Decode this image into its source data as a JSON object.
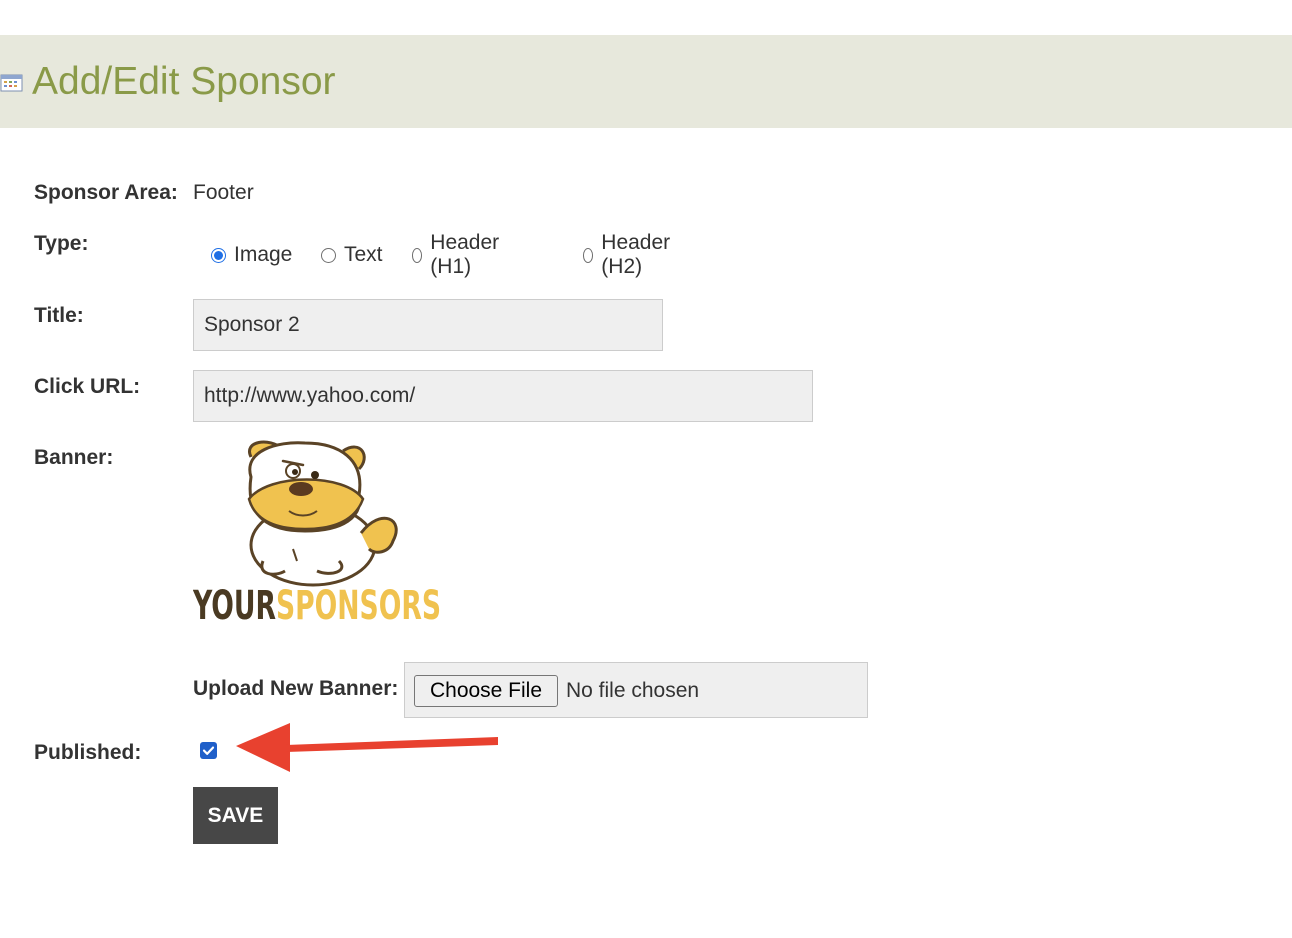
{
  "header": {
    "title": "Add/Edit Sponsor",
    "icon": "calendar-icon"
  },
  "form": {
    "sponsor_area": {
      "label": "Sponsor Area:",
      "value": "Footer"
    },
    "type": {
      "label": "Type:",
      "options": [
        {
          "label": "Image",
          "checked": true
        },
        {
          "label": "Text",
          "checked": false
        },
        {
          "label": "Header (H1)",
          "checked": false
        },
        {
          "label": "Header (H2)",
          "checked": false
        }
      ]
    },
    "title": {
      "label": "Title:",
      "value": "Sponsor 2"
    },
    "click_url": {
      "label": "Click URL:",
      "value": "http://www.yahoo.com/"
    },
    "banner": {
      "label": "Banner:",
      "logo_text_dark": "YOUR",
      "logo_text_accent": "SPONSORS",
      "logo_dark_color": "#4a3a22",
      "logo_accent_color": "#f0c24f"
    },
    "upload": {
      "label": "Upload New Banner:",
      "button_label": "Choose File",
      "status": "No file chosen"
    },
    "published": {
      "label": "Published:",
      "checked": true
    },
    "save_label": "SAVE"
  },
  "annotation": {
    "arrow_color": "#e8412f",
    "points_to": "published-checkbox"
  },
  "colors": {
    "title": "#8a9a48",
    "header_bg": "#e7e8dc",
    "radio_accent": "#1f6fe5",
    "save_bg": "#474747"
  }
}
